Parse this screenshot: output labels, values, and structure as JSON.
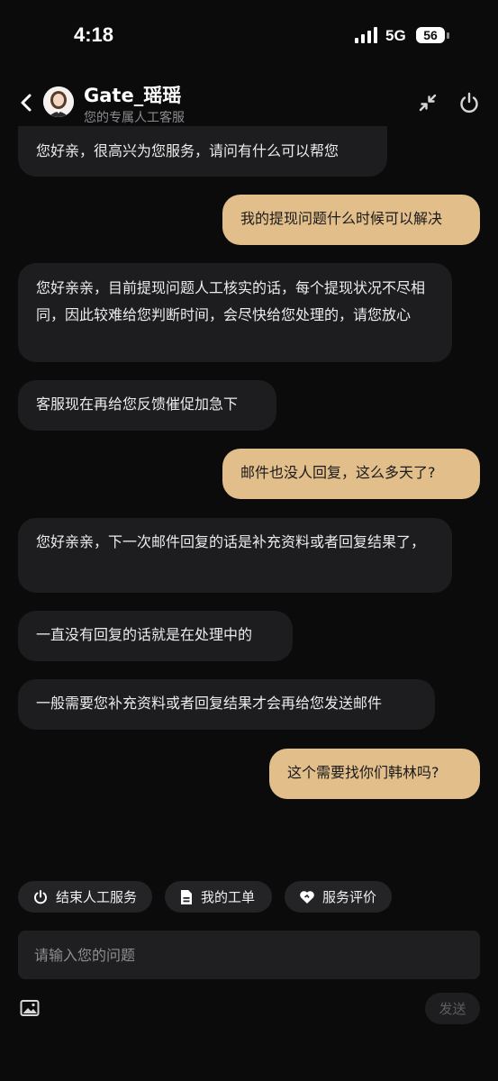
{
  "status_bar": {
    "time": "4:18",
    "network": "5G",
    "battery": "56"
  },
  "header": {
    "agent_name": "Gate_瑶瑶",
    "subtitle": "您的专属人工客服",
    "icons": [
      "back-icon",
      "avatar",
      "minimize-icon",
      "power-icon"
    ]
  },
  "messages": [
    {
      "role": "agent",
      "text": "您好亲，很高兴为您服务，请问有什么可以帮您"
    },
    {
      "role": "user",
      "text": "我的提现问题什么时候可以解决"
    },
    {
      "role": "agent",
      "text": "您好亲亲，目前提现问题人工核实的话，每个提现状况不尽相同，因此较难给您判断时间，会尽快给您处理的，请您放心"
    },
    {
      "role": "agent",
      "text": "客服现在再给您反馈催促加急下"
    },
    {
      "role": "user",
      "text": "邮件也没人回复，这么多天了?"
    },
    {
      "role": "agent",
      "text": "您好亲亲，下一次邮件回复的话是补充资料或者回复结果了，"
    },
    {
      "role": "agent",
      "text": "一直没有回复的话就是在处理中的"
    },
    {
      "role": "agent",
      "text": "一般需要您补充资料或者回复结果才会再给您发送邮件"
    },
    {
      "role": "user",
      "text": "这个需要找你们韩林吗?"
    }
  ],
  "actions": {
    "end_service": "结束人工服务",
    "my_tickets": "我的工单",
    "rate_service": "服务评价"
  },
  "composer": {
    "placeholder": "请输入您的问题",
    "send_label": "发送"
  },
  "colors": {
    "background": "#0b0b0c",
    "agent_bubble": "#1d1d1f",
    "user_bubble": "#e2be8b",
    "chip": "#242427"
  }
}
